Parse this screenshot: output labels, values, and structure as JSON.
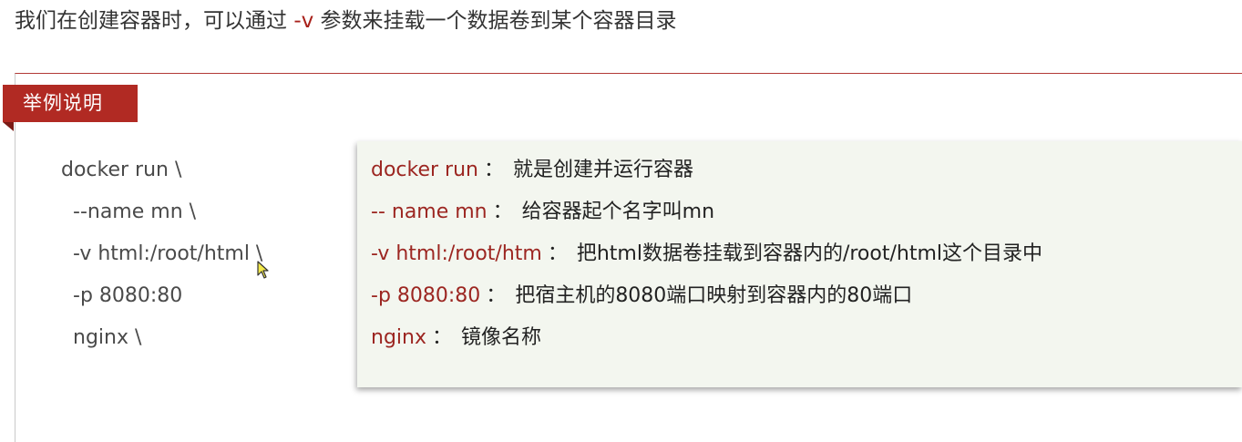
{
  "intro": {
    "before": "我们在创建容器时，可以通过",
    "flag": "-v",
    "after": "参数来挂载一个数据卷到某个容器目录"
  },
  "example_tag": "举例说明",
  "code_lines": [
    "docker run \\",
    "--name mn \\",
    "-v html:/root/html \\",
    "-p 8080:80",
    "nginx \\"
  ],
  "explanations": [
    {
      "term": "docker run",
      "sep": "：",
      "desc": "就是创建并运行容器"
    },
    {
      "term": "-- name mn",
      "sep": "：",
      "desc": "给容器起个名字叫mn"
    },
    {
      "term": "-v html:/root/htm",
      "sep": "：",
      "desc": "把html数据卷挂载到容器内的/root/html这个目录中"
    },
    {
      "term": "-p 8080:80",
      "sep": "：",
      "desc": "把宿主机的8080端口映射到容器内的80端口"
    },
    {
      "term": "nginx",
      "sep": "：",
      "desc": "镜像名称"
    }
  ],
  "colors": {
    "accent": "#b12a23",
    "term": "#9c2621",
    "box_bg": "#f3f6ef"
  },
  "icons": {
    "cursor": "mouse-pointer-icon"
  }
}
